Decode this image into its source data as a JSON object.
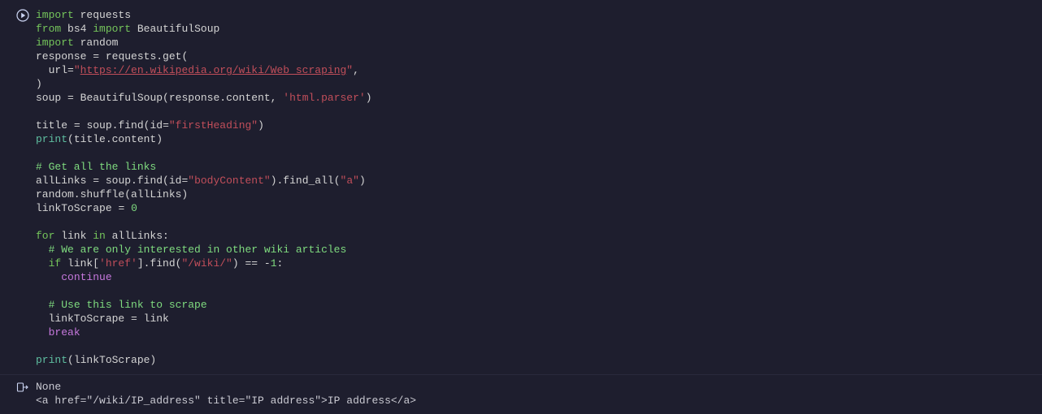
{
  "code": {
    "lines": [
      [
        {
          "cls": "tok-kw",
          "t": "import"
        },
        {
          "cls": "tok-plain",
          "t": " "
        },
        {
          "cls": "tok-mod",
          "t": "requests"
        }
      ],
      [
        {
          "cls": "tok-kw",
          "t": "from"
        },
        {
          "cls": "tok-plain",
          "t": " "
        },
        {
          "cls": "tok-mod",
          "t": "bs4"
        },
        {
          "cls": "tok-plain",
          "t": " "
        },
        {
          "cls": "tok-kw",
          "t": "import"
        },
        {
          "cls": "tok-plain",
          "t": " "
        },
        {
          "cls": "tok-mod",
          "t": "BeautifulSoup"
        }
      ],
      [
        {
          "cls": "tok-kw",
          "t": "import"
        },
        {
          "cls": "tok-plain",
          "t": " "
        },
        {
          "cls": "tok-mod",
          "t": "random"
        }
      ],
      [
        {
          "cls": "tok-def",
          "t": "response"
        },
        {
          "cls": "tok-plain",
          "t": " "
        },
        {
          "cls": "tok-op",
          "t": "="
        },
        {
          "cls": "tok-plain",
          "t": " requests.get("
        }
      ],
      [
        {
          "cls": "tok-plain",
          "t": "  url"
        },
        {
          "cls": "tok-op",
          "t": "="
        },
        {
          "cls": "tok-str",
          "t": "\""
        },
        {
          "cls": "tok-url",
          "t": "https://en.wikipedia.org/wiki/Web_scraping"
        },
        {
          "cls": "tok-str",
          "t": "\""
        },
        {
          "cls": "tok-plain",
          "t": ","
        }
      ],
      [
        {
          "cls": "tok-plain",
          "t": ")"
        }
      ],
      [
        {
          "cls": "tok-def",
          "t": "soup"
        },
        {
          "cls": "tok-plain",
          "t": " "
        },
        {
          "cls": "tok-op",
          "t": "="
        },
        {
          "cls": "tok-plain",
          "t": " BeautifulSoup(response.content, "
        },
        {
          "cls": "tok-str",
          "t": "'html.parser'"
        },
        {
          "cls": "tok-plain",
          "t": ")"
        }
      ],
      [
        {
          "cls": "tok-plain",
          "t": " "
        }
      ],
      [
        {
          "cls": "tok-def",
          "t": "title"
        },
        {
          "cls": "tok-plain",
          "t": " "
        },
        {
          "cls": "tok-op",
          "t": "="
        },
        {
          "cls": "tok-plain",
          "t": " soup.find(id"
        },
        {
          "cls": "tok-op",
          "t": "="
        },
        {
          "cls": "tok-str",
          "t": "\"firstHeading\""
        },
        {
          "cls": "tok-plain",
          "t": ")"
        }
      ],
      [
        {
          "cls": "tok-builtin",
          "t": "print"
        },
        {
          "cls": "tok-plain",
          "t": "(title.content)"
        }
      ],
      [
        {
          "cls": "tok-plain",
          "t": " "
        }
      ],
      [
        {
          "cls": "tok-comment",
          "t": "# Get all the links"
        }
      ],
      [
        {
          "cls": "tok-def",
          "t": "allLinks"
        },
        {
          "cls": "tok-plain",
          "t": " "
        },
        {
          "cls": "tok-op",
          "t": "="
        },
        {
          "cls": "tok-plain",
          "t": " soup.find(id"
        },
        {
          "cls": "tok-op",
          "t": "="
        },
        {
          "cls": "tok-str",
          "t": "\"bodyContent\""
        },
        {
          "cls": "tok-plain",
          "t": ").find_all("
        },
        {
          "cls": "tok-str",
          "t": "\"a\""
        },
        {
          "cls": "tok-plain",
          "t": ")"
        }
      ],
      [
        {
          "cls": "tok-plain",
          "t": "random.shuffle(allLinks)"
        }
      ],
      [
        {
          "cls": "tok-def",
          "t": "linkToScrape"
        },
        {
          "cls": "tok-plain",
          "t": " "
        },
        {
          "cls": "tok-op",
          "t": "="
        },
        {
          "cls": "tok-plain",
          "t": " "
        },
        {
          "cls": "tok-num",
          "t": "0"
        }
      ],
      [
        {
          "cls": "tok-plain",
          "t": " "
        }
      ],
      [
        {
          "cls": "tok-kw",
          "t": "for"
        },
        {
          "cls": "tok-plain",
          "t": " link "
        },
        {
          "cls": "tok-kw",
          "t": "in"
        },
        {
          "cls": "tok-plain",
          "t": " allLinks:"
        }
      ],
      [
        {
          "cls": "tok-plain",
          "t": "  "
        },
        {
          "cls": "tok-comment",
          "t": "# We are only interested in other wiki articles"
        }
      ],
      [
        {
          "cls": "tok-plain",
          "t": "  "
        },
        {
          "cls": "tok-kw",
          "t": "if"
        },
        {
          "cls": "tok-plain",
          "t": " link["
        },
        {
          "cls": "tok-str",
          "t": "'href'"
        },
        {
          "cls": "tok-plain",
          "t": "].find("
        },
        {
          "cls": "tok-str",
          "t": "\"/wiki/\""
        },
        {
          "cls": "tok-plain",
          "t": ") "
        },
        {
          "cls": "tok-op",
          "t": "=="
        },
        {
          "cls": "tok-plain",
          "t": " "
        },
        {
          "cls": "tok-op",
          "t": "-"
        },
        {
          "cls": "tok-num",
          "t": "1"
        },
        {
          "cls": "tok-plain",
          "t": ":"
        }
      ],
      [
        {
          "cls": "tok-plain",
          "t": "    "
        },
        {
          "cls": "tok-flow",
          "t": "continue"
        }
      ],
      [
        {
          "cls": "tok-plain",
          "t": " "
        }
      ],
      [
        {
          "cls": "tok-plain",
          "t": "  "
        },
        {
          "cls": "tok-comment",
          "t": "# Use this link to scrape"
        }
      ],
      [
        {
          "cls": "tok-plain",
          "t": "  linkToScrape "
        },
        {
          "cls": "tok-op",
          "t": "="
        },
        {
          "cls": "tok-plain",
          "t": " link"
        }
      ],
      [
        {
          "cls": "tok-plain",
          "t": "  "
        },
        {
          "cls": "tok-flow",
          "t": "break"
        }
      ],
      [
        {
          "cls": "tok-plain",
          "t": " "
        }
      ],
      [
        {
          "cls": "tok-builtin",
          "t": "print"
        },
        {
          "cls": "tok-plain",
          "t": "(linkToScrape)"
        }
      ]
    ]
  },
  "output": {
    "lines": [
      "None",
      "<a href=\"/wiki/IP_address\" title=\"IP address\">IP address</a>"
    ]
  },
  "icons": {
    "run": "run-cell-icon",
    "output": "output-indicator-icon"
  }
}
